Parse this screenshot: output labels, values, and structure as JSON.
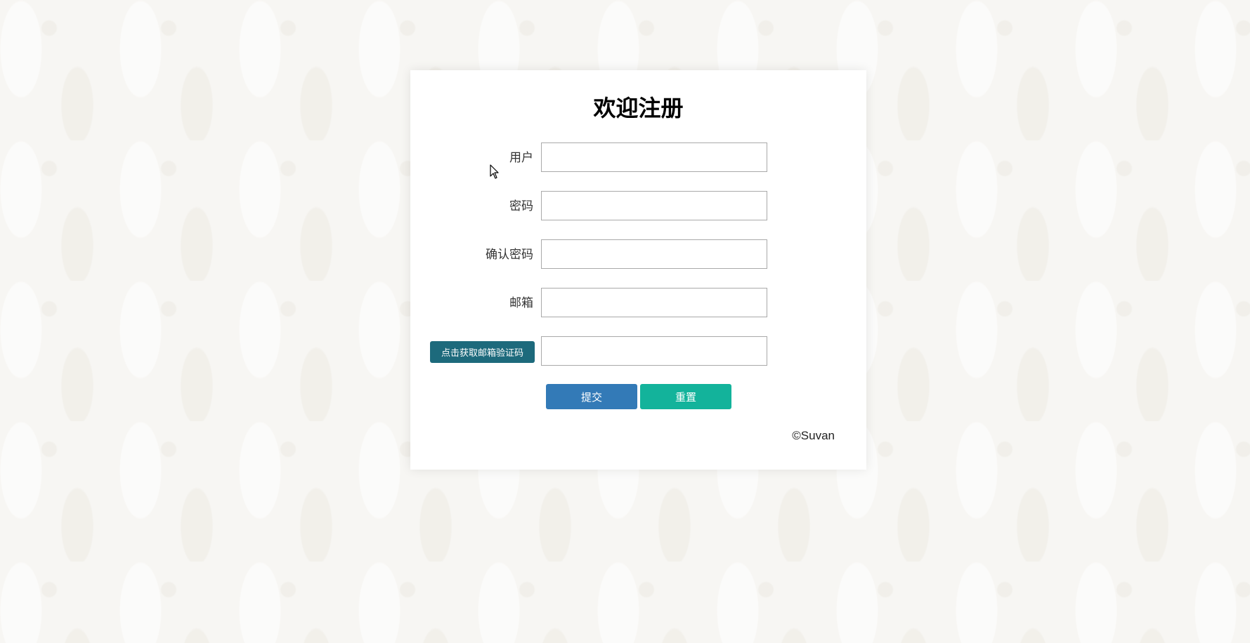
{
  "form": {
    "title": "欢迎注册",
    "fields": [
      {
        "label": "用户",
        "value": ""
      },
      {
        "label": "密码",
        "value": ""
      },
      {
        "label": "确认密码",
        "value": ""
      },
      {
        "label": "邮箱",
        "value": ""
      }
    ],
    "verification": {
      "button_label": "点击获取邮箱验证码",
      "value": ""
    },
    "submit_label": "提交",
    "reset_label": "重置",
    "copyright": "©Suvan"
  },
  "colors": {
    "code_button": "#1d6a7c",
    "submit_button": "#337ab7",
    "reset_button": "#13b39b"
  }
}
